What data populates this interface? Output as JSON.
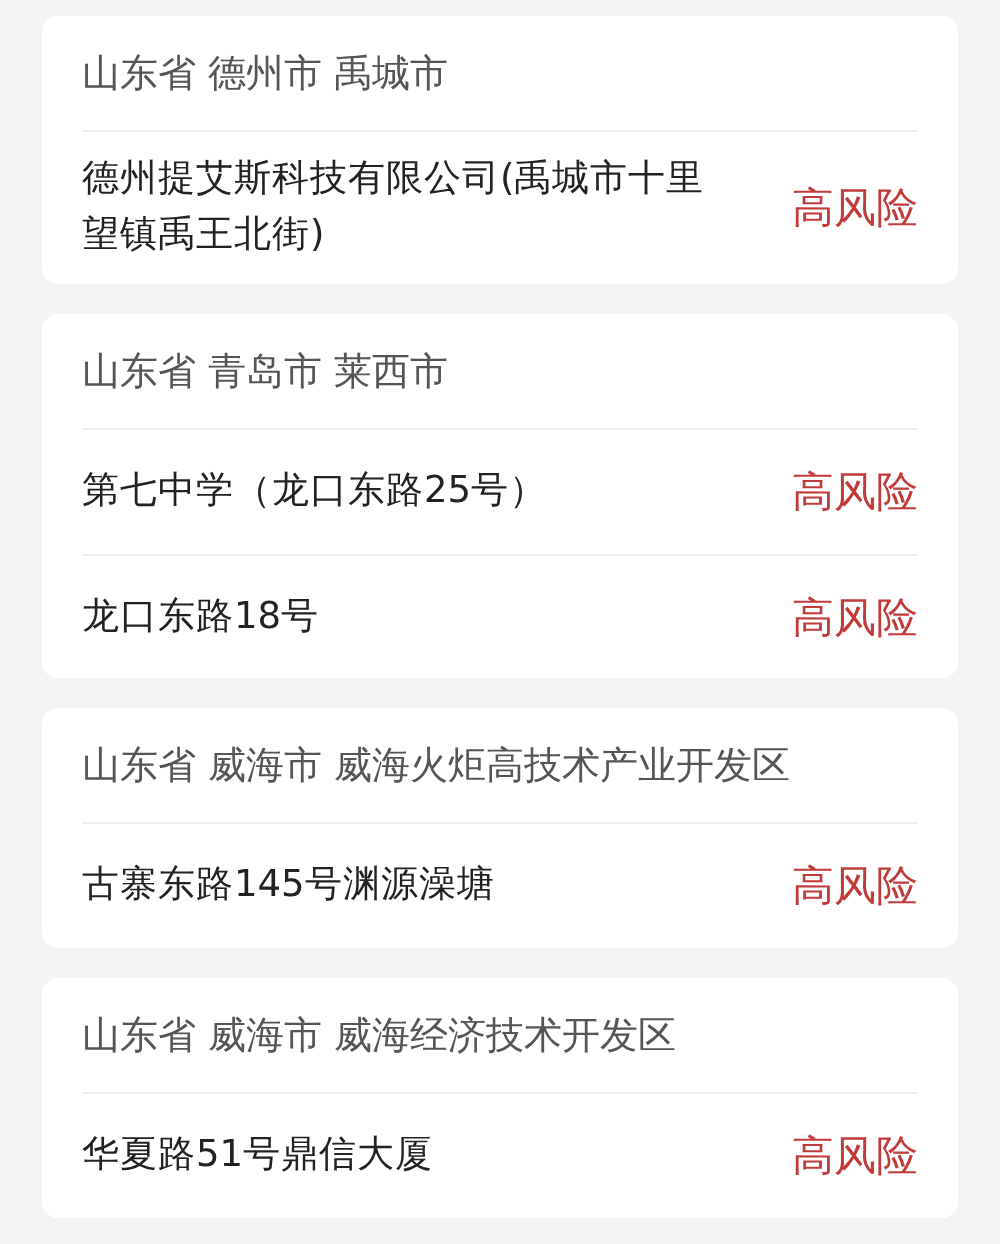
{
  "areas": [
    {
      "region": "山东省 德州市 禹城市",
      "places": [
        {
          "name": "德州提艾斯科技有限公司(禹城市十里望镇禹王北街)",
          "risk": {
            "text": "高风险",
            "kind": "high"
          }
        }
      ]
    },
    {
      "region": "山东省 青岛市 莱西市",
      "places": [
        {
          "name": "第七中学（龙口东路25号）",
          "risk": {
            "text": "高风险",
            "kind": "high"
          }
        },
        {
          "name": "龙口东路18号",
          "risk": {
            "text": "高风险",
            "kind": "high"
          }
        }
      ]
    },
    {
      "region": "山东省 威海市 威海火炬高技术产业开发区",
      "places": [
        {
          "name": "古寨东路145号渊源澡塘",
          "risk": {
            "text": "高风险",
            "kind": "high"
          }
        }
      ]
    },
    {
      "region": "山东省 威海市 威海经济技术开发区",
      "places": [
        {
          "name": "华夏路51号鼎信大厦",
          "risk": {
            "text": "高风险",
            "kind": "high"
          }
        }
      ]
    }
  ]
}
